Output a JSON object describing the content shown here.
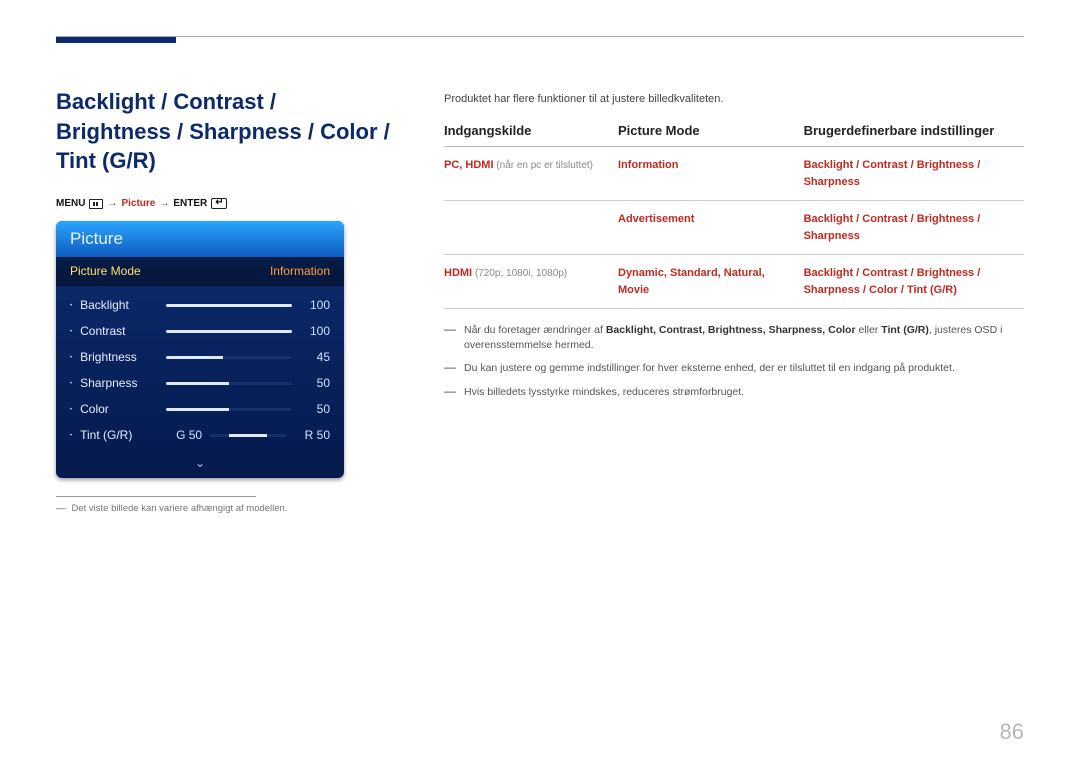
{
  "page_number": "86",
  "title": "Backlight / Contrast / Brightness / Sharpness / Color / Tint (G/R)",
  "menu_path": {
    "menu": "MENU",
    "step": "Picture",
    "enter": "ENTER"
  },
  "osd": {
    "title": "Picture",
    "mode_label": "Picture Mode",
    "mode_value": "Information",
    "rows": [
      {
        "label": "Backlight",
        "value": "100",
        "pct": 100
      },
      {
        "label": "Contrast",
        "value": "100",
        "pct": 100
      },
      {
        "label": "Brightness",
        "value": "45",
        "pct": 45
      },
      {
        "label": "Sharpness",
        "value": "50",
        "pct": 50
      },
      {
        "label": "Color",
        "value": "50",
        "pct": 50
      }
    ],
    "tint": {
      "label": "Tint (G/R)",
      "g": "G 50",
      "r": "R 50"
    }
  },
  "caption": "Det viste billede kan variere afhængigt af modellen.",
  "intro": "Produktet har flere funktioner til at justere billedkvaliteten.",
  "table": {
    "headers": [
      "Indgangskilde",
      "Picture Mode",
      "Brugerdefinerbare indstillinger"
    ],
    "rows": [
      {
        "src_red": "PC, HDMI",
        "src_gray": " (når en pc er tilsluttet)",
        "mode": "Information",
        "settings": "Backlight / Contrast / Brightness / Sharpness"
      },
      {
        "src_red": "",
        "src_gray": "",
        "mode": "Advertisement",
        "settings": "Backlight / Contrast / Brightness / Sharpness"
      },
      {
        "src_red": "HDMI",
        "src_gray": " (720p, 1080i, 1080p)",
        "mode": "Dynamic, Standard, Natural, Movie",
        "settings": "Backlight / Contrast / Brightness / Sharpness / Color / Tint (G/R)"
      }
    ]
  },
  "notes": [
    {
      "pre": "Når du foretager ændringer af ",
      "bold": "Backlight, Contrast, Brightness, Sharpness, Color",
      "mid": " eller ",
      "bold2": "Tint (G/R)",
      "post": ", justeres OSD i overensstemmelse hermed."
    },
    {
      "text": "Du kan justere og gemme indstillinger for hver eksterne enhed, der er tilsluttet til en indgang på produktet."
    },
    {
      "text": "Hvis billedets lysstyrke mindskes, reduceres strømforbruget."
    }
  ]
}
